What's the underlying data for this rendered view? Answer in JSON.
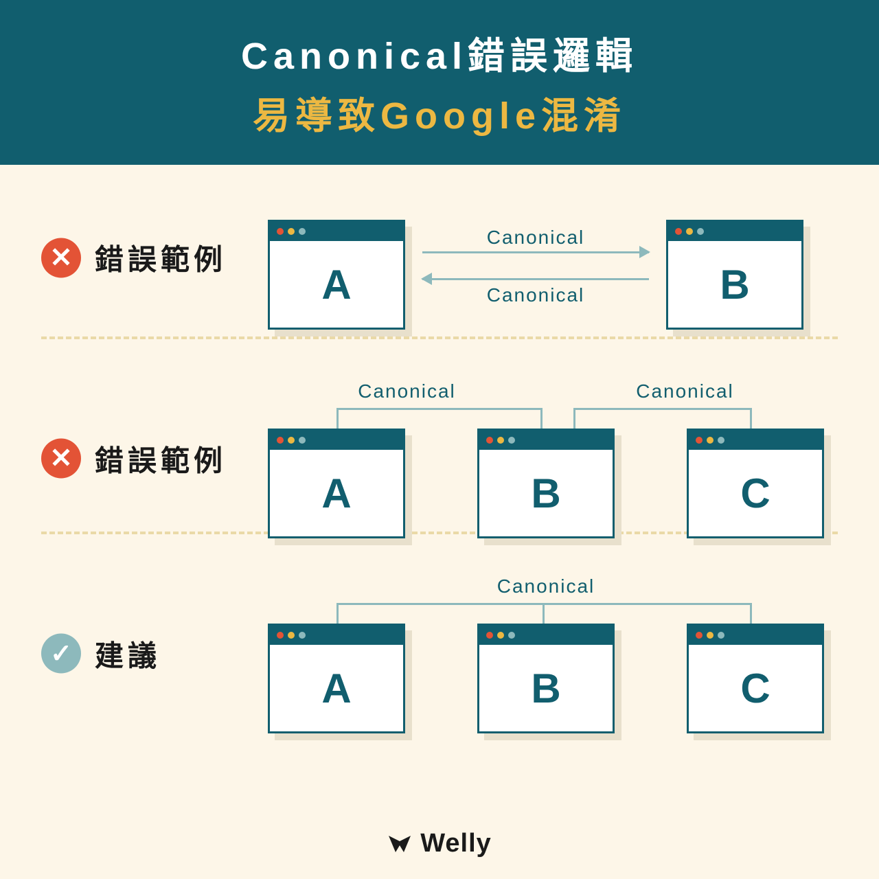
{
  "header": {
    "line1": "Canonical錯誤邏輯",
    "line2": "易導致Google混淆"
  },
  "sections": {
    "s1": {
      "label": "錯誤範例",
      "windowA": "A",
      "windowB": "B",
      "arrowTop": "Canonical",
      "arrowBottom": "Canonical"
    },
    "s2": {
      "label": "錯誤範例",
      "windowA": "A",
      "windowB": "B",
      "windowC": "C",
      "labelLeft": "Canonical",
      "labelRight": "Canonical"
    },
    "s3": {
      "label": "建議",
      "windowA": "A",
      "windowB": "B",
      "windowC": "C",
      "labelCenter": "Canonical"
    }
  },
  "footer": {
    "brand": "Welly"
  },
  "colors": {
    "headerBg": "#115e6e",
    "accent": "#ecb842",
    "bodyBg": "#fdf6e8",
    "error": "#e35336",
    "success": "#8db9bc"
  }
}
